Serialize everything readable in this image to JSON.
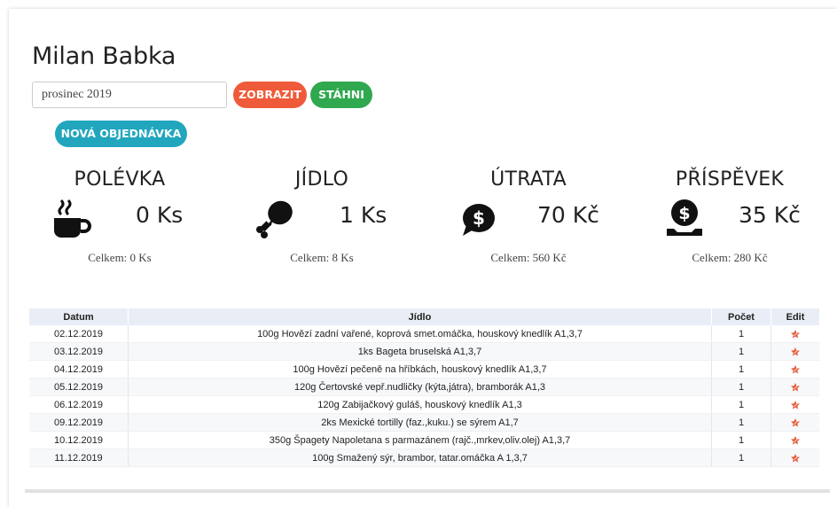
{
  "user": {
    "name": "Milan Babka"
  },
  "filter": {
    "month_value": "prosinec 2019",
    "show_label": "ZOBRAZIT",
    "download_label": "STÁHNI",
    "new_order_label": "NOVÁ OBJEDNÁVKA"
  },
  "colors": {
    "show": "#ef5a3a",
    "download": "#2fa84f",
    "new_order": "#21a6bd",
    "edit_icon": "#e55a3a"
  },
  "stats": [
    {
      "title": "POLÉVKA",
      "icon": "coffee-cup-icon",
      "value": "0 Ks",
      "total": "Celkem: 0 Ks"
    },
    {
      "title": "JÍDLO",
      "icon": "drumstick-icon",
      "value": "1 Ks",
      "total": "Celkem: 8 Ks"
    },
    {
      "title": "ÚTRATA",
      "icon": "money-chat-icon",
      "value": "70 Kč",
      "total": "Celkem: 560 Kč"
    },
    {
      "title": "PŘÍSPĚVEK",
      "icon": "hand-coin-icon",
      "value": "35 Kč",
      "total": "Celkem: 280 Kč"
    }
  ],
  "table": {
    "headers": {
      "date": "Datum",
      "food": "Jídlo",
      "count": "Počet",
      "edit": "Edit"
    },
    "rows": [
      {
        "date": "02.12.2019",
        "food": "100g Hovězí zadní vařené, koprová smet.omáčka, houskový knedlík A1,3,7",
        "count": "1"
      },
      {
        "date": "03.12.2019",
        "food": "1ks Bageta bruselská A1,3,7",
        "count": "1"
      },
      {
        "date": "04.12.2019",
        "food": "100g Hovězí pečeně na hříbkách, houskový knedlík A1,3,7",
        "count": "1"
      },
      {
        "date": "05.12.2019",
        "food": "120g Čertovské vepř.nudličky (kýta,játra), bramborák A1,3",
        "count": "1"
      },
      {
        "date": "06.12.2019",
        "food": "120g Zabijačkový guláš, houskový knedlík A1,3",
        "count": "1"
      },
      {
        "date": "09.12.2019",
        "food": "2ks Mexické tortilly (faz.,kuku.) se sýrem A1,7",
        "count": "1"
      },
      {
        "date": "10.12.2019",
        "food": "350g Špagety Napoletana s parmazánem (rajč.,mrkev,oliv.olej) A1,3,7",
        "count": "1"
      },
      {
        "date": "11.12.2019",
        "food": "100g Smažený sýr, brambor, tatar.omáčka A 1,3,7",
        "count": "1"
      }
    ]
  }
}
